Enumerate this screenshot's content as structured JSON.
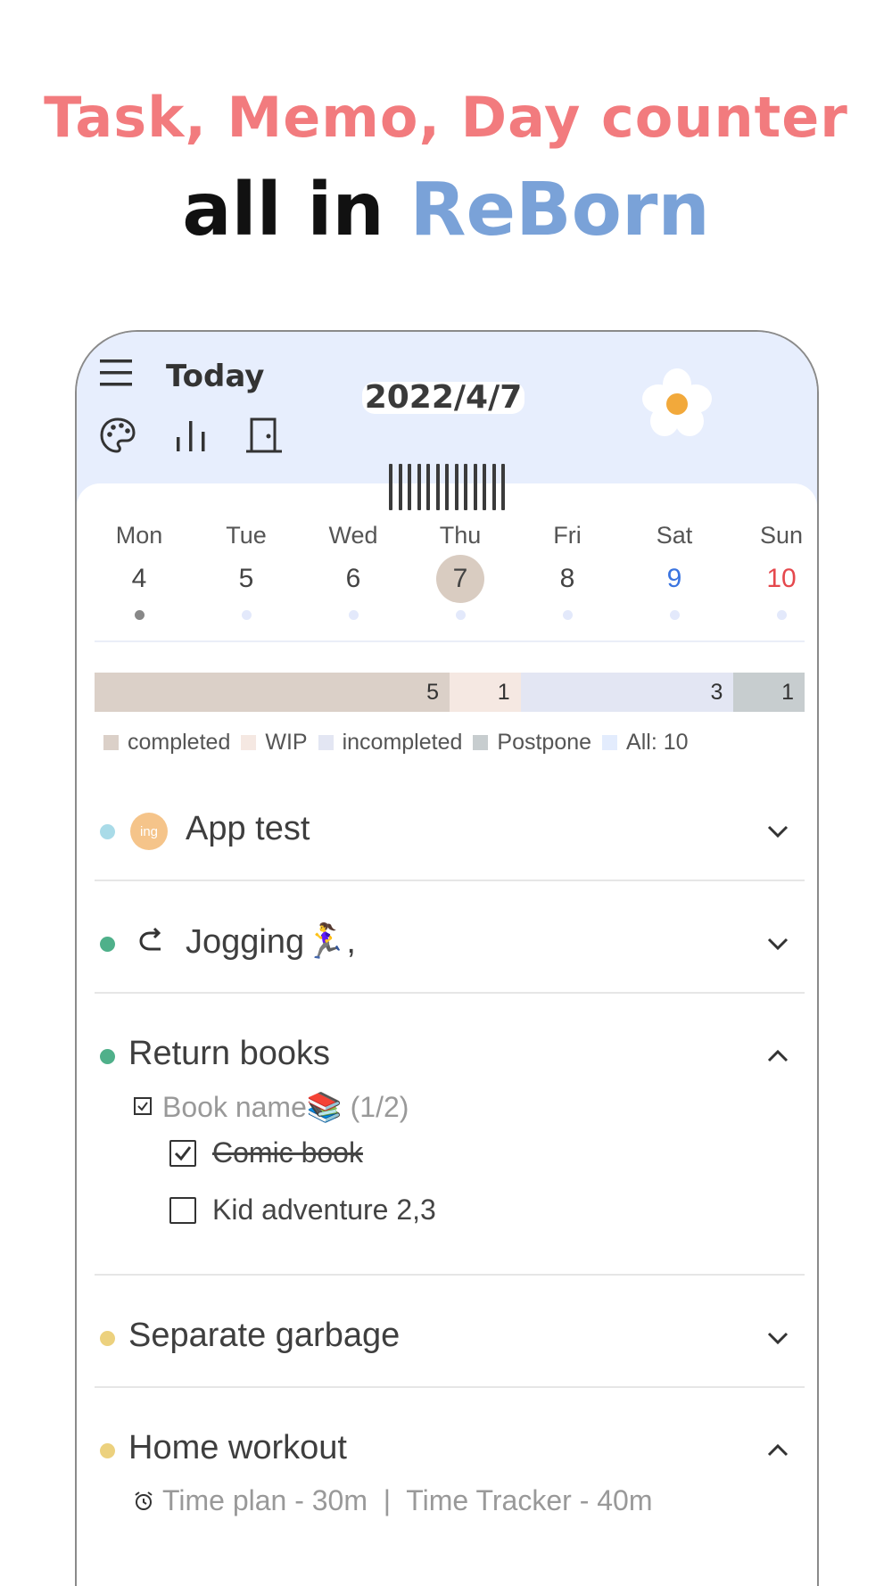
{
  "headline": {
    "line1": "Task, Memo, Day counter",
    "line2_prefix": "all in ",
    "line2_brand": "ReBorn"
  },
  "colors": {
    "headline_pink": "#f27b7e",
    "brand_blue": "#7aa2d8",
    "header_bg": "#e7eefd",
    "completed": "#dbd0c8",
    "wip": "#f5e8e2",
    "incompleted": "#e3e6f3",
    "postpone": "#c7cdcf",
    "all": "#e3ecfd"
  },
  "header": {
    "menu_icon": "hamburger-menu-icon",
    "title": "Today",
    "date": "2022/4/7",
    "icons": [
      "palette-icon",
      "stats-bar-icon",
      "door-exit-icon",
      "flower-icon"
    ]
  },
  "week": [
    {
      "name": "Mon",
      "num": "4",
      "color": "#444444",
      "selected": false,
      "has_task": true
    },
    {
      "name": "Tue",
      "num": "5",
      "color": "#444444",
      "selected": false,
      "has_task": false
    },
    {
      "name": "Wed",
      "num": "6",
      "color": "#444444",
      "selected": false,
      "has_task": false
    },
    {
      "name": "Thu",
      "num": "7",
      "color": "#444444",
      "selected": true,
      "has_task": false
    },
    {
      "name": "Fri",
      "num": "8",
      "color": "#444444",
      "selected": false,
      "has_task": false
    },
    {
      "name": "Sat",
      "num": "9",
      "color": "#3a74e0",
      "selected": false,
      "has_task": false
    },
    {
      "name": "Sun",
      "num": "10",
      "color": "#e5484d",
      "selected": false,
      "has_task": false
    }
  ],
  "progress": {
    "completed": 5,
    "wip": 1,
    "incompleted": 3,
    "postpone": 1
  },
  "legend": {
    "completed": "completed",
    "wip": "WIP",
    "incompleted": "incompleted",
    "postpone": "Postpone",
    "all": "All: 10"
  },
  "tasks": [
    {
      "title": "App test",
      "dot_color": "#a9dbe8",
      "badge": "ing",
      "expanded": false
    },
    {
      "title": "Jogging🏃‍♀️,",
      "dot_color": "#4fb08a",
      "icon": "repeat-icon",
      "expanded": false
    },
    {
      "title": "Return books",
      "dot_color": "#4fb08a",
      "expanded": true,
      "checklist_title": "Book name📚 (1/2)",
      "items": [
        {
          "label": "Comic book",
          "checked": true
        },
        {
          "label": "Kid adventure 2,3",
          "checked": false
        }
      ]
    },
    {
      "title": "Separate garbage",
      "dot_color": "#ecd17e",
      "expanded": false
    },
    {
      "title": "Home workout",
      "dot_color": "#ecd17e",
      "expanded": true,
      "time_plan": "Time plan - 30m  |  Time Tracker - 40m"
    }
  ]
}
